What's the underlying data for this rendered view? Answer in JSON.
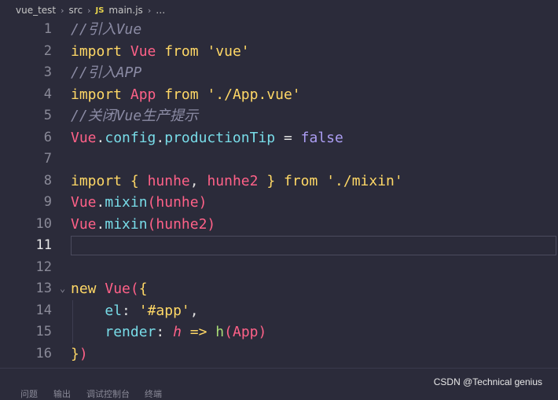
{
  "breadcrumb": {
    "folder1": "vue_test",
    "folder2": "src",
    "file_icon": "JS",
    "file": "main.js",
    "more": "…",
    "sep": "›"
  },
  "lines": [
    {
      "n": "1",
      "tokens": [
        {
          "c": "cm",
          "t": "//引入Vue"
        }
      ]
    },
    {
      "n": "2",
      "tokens": [
        {
          "c": "kw",
          "t": "import"
        },
        {
          "c": "plain",
          "t": " "
        },
        {
          "c": "id",
          "t": "Vue"
        },
        {
          "c": "plain",
          "t": " "
        },
        {
          "c": "kw",
          "t": "from"
        },
        {
          "c": "plain",
          "t": " "
        },
        {
          "c": "str",
          "t": "'vue'"
        }
      ]
    },
    {
      "n": "3",
      "tokens": [
        {
          "c": "cm",
          "t": "//引入APP"
        }
      ]
    },
    {
      "n": "4",
      "tokens": [
        {
          "c": "kw",
          "t": "import"
        },
        {
          "c": "plain",
          "t": " "
        },
        {
          "c": "id",
          "t": "App"
        },
        {
          "c": "plain",
          "t": " "
        },
        {
          "c": "kw",
          "t": "from"
        },
        {
          "c": "plain",
          "t": " "
        },
        {
          "c": "str",
          "t": "'./App.vue'"
        }
      ]
    },
    {
      "n": "5",
      "tokens": [
        {
          "c": "cm",
          "t": "//关闭Vue生产提示"
        }
      ]
    },
    {
      "n": "6",
      "tokens": [
        {
          "c": "id",
          "t": "Vue"
        },
        {
          "c": "op",
          "t": "."
        },
        {
          "c": "prop",
          "t": "config"
        },
        {
          "c": "op",
          "t": "."
        },
        {
          "c": "prop",
          "t": "productionTip"
        },
        {
          "c": "plain",
          "t": " "
        },
        {
          "c": "op",
          "t": "="
        },
        {
          "c": "plain",
          "t": " "
        },
        {
          "c": "vio",
          "t": "false"
        }
      ]
    },
    {
      "n": "7",
      "tokens": []
    },
    {
      "n": "8",
      "tokens": [
        {
          "c": "kw",
          "t": "import"
        },
        {
          "c": "plain",
          "t": " "
        },
        {
          "c": "brk",
          "t": "{"
        },
        {
          "c": "plain",
          "t": " "
        },
        {
          "c": "id",
          "t": "hunhe"
        },
        {
          "c": "op",
          "t": ","
        },
        {
          "c": "plain",
          "t": " "
        },
        {
          "c": "id",
          "t": "hunhe2"
        },
        {
          "c": "plain",
          "t": " "
        },
        {
          "c": "brk",
          "t": "}"
        },
        {
          "c": "plain",
          "t": " "
        },
        {
          "c": "kw",
          "t": "from"
        },
        {
          "c": "plain",
          "t": " "
        },
        {
          "c": "str",
          "t": "'./mixin'"
        }
      ]
    },
    {
      "n": "9",
      "tokens": [
        {
          "c": "id",
          "t": "Vue"
        },
        {
          "c": "op",
          "t": "."
        },
        {
          "c": "prop",
          "t": "mixin"
        },
        {
          "c": "par",
          "t": "("
        },
        {
          "c": "id",
          "t": "hunhe"
        },
        {
          "c": "par",
          "t": ")"
        }
      ]
    },
    {
      "n": "10",
      "tokens": [
        {
          "c": "id",
          "t": "Vue"
        },
        {
          "c": "op",
          "t": "."
        },
        {
          "c": "prop",
          "t": "mixin"
        },
        {
          "c": "par",
          "t": "("
        },
        {
          "c": "id",
          "t": "hunhe2"
        },
        {
          "c": "par",
          "t": ")"
        }
      ]
    },
    {
      "n": "11",
      "tokens": [],
      "active": true
    },
    {
      "n": "12",
      "tokens": []
    },
    {
      "n": "13",
      "fold": true,
      "tokens": [
        {
          "c": "kw",
          "t": "new"
        },
        {
          "c": "plain",
          "t": " "
        },
        {
          "c": "id",
          "t": "Vue"
        },
        {
          "c": "par",
          "t": "("
        },
        {
          "c": "brk",
          "t": "{"
        }
      ]
    },
    {
      "n": "14",
      "tokens": [
        {
          "c": "plain",
          "t": "    "
        },
        {
          "c": "prop",
          "t": "el"
        },
        {
          "c": "op",
          "t": ":"
        },
        {
          "c": "plain",
          "t": " "
        },
        {
          "c": "str",
          "t": "'#app'"
        },
        {
          "c": "op",
          "t": ","
        }
      ]
    },
    {
      "n": "15",
      "tokens": [
        {
          "c": "plain",
          "t": "    "
        },
        {
          "c": "prop",
          "t": "render"
        },
        {
          "c": "op",
          "t": ":"
        },
        {
          "c": "plain",
          "t": " "
        },
        {
          "c": "arr",
          "t": "h"
        },
        {
          "c": "plain",
          "t": " "
        },
        {
          "c": "kw",
          "t": "=>"
        },
        {
          "c": "plain",
          "t": " "
        },
        {
          "c": "grn",
          "t": "h"
        },
        {
          "c": "par",
          "t": "("
        },
        {
          "c": "id",
          "t": "App"
        },
        {
          "c": "par",
          "t": ")"
        }
      ]
    },
    {
      "n": "16",
      "tokens": [
        {
          "c": "brk",
          "t": "}"
        },
        {
          "c": "par",
          "t": ")"
        }
      ]
    }
  ],
  "panel_tabs": [
    "问题",
    "输出",
    "调试控制台",
    "终端"
  ],
  "watermark": "CSDN @Technical genius"
}
